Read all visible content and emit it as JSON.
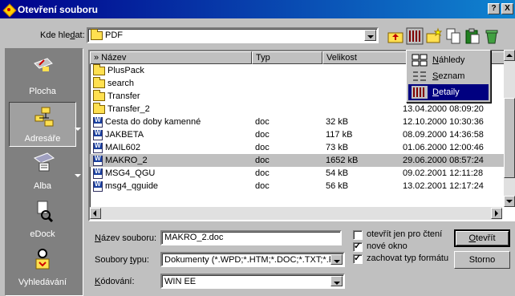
{
  "window": {
    "title": "Otevření souboru",
    "help_btn": "?",
    "close_btn": "X"
  },
  "lookin": {
    "label_pre": "Kde hle",
    "label_u": "d",
    "label_post": "at:",
    "value": "PDF"
  },
  "sidebar": [
    {
      "label": "Plocha"
    },
    {
      "label": "Adresáře"
    },
    {
      "label": "Alba"
    },
    {
      "label": "eDock"
    },
    {
      "label": "Vyhledávání"
    }
  ],
  "list": {
    "columns": [
      "» Název",
      "Typ",
      "Velikost",
      ""
    ],
    "rows": [
      {
        "name": "PlusPack",
        "type": "",
        "size": "",
        "date": "",
        "icon": "folder"
      },
      {
        "name": "search",
        "type": "",
        "size": "",
        "date": "",
        "icon": "folder"
      },
      {
        "name": "Transfer",
        "type": "",
        "size": "",
        "date": "",
        "icon": "folder"
      },
      {
        "name": "Transfer_2",
        "type": "",
        "size": "",
        "date": "13.04.2000 08:09:20",
        "icon": "folder"
      },
      {
        "name": "Cesta do doby kamenné",
        "type": "doc",
        "size": "32 kB",
        "date": "12.10.2000 10:30:36",
        "icon": "doc"
      },
      {
        "name": "JAKBETA",
        "type": "doc",
        "size": "117 kB",
        "date": "08.09.2000 14:36:58",
        "icon": "doc"
      },
      {
        "name": "MAIL602",
        "type": "doc",
        "size": "73 kB",
        "date": "01.06.2000 12:00:46",
        "icon": "doc"
      },
      {
        "name": "MAKRO_2",
        "type": "doc",
        "size": "1652 kB",
        "date": "29.06.2000 08:57:24",
        "icon": "doc"
      },
      {
        "name": "MSG4_QGU",
        "type": "doc",
        "size": "54 kB",
        "date": "09.02.2001 12:11:28",
        "icon": "doc"
      },
      {
        "name": "msg4_qguide",
        "type": "doc",
        "size": "56 kB",
        "date": "13.02.2001 12:17:24",
        "icon": "doc"
      }
    ],
    "selected_index": 7
  },
  "view_menu": {
    "items": [
      {
        "pre": "",
        "u": "N",
        "post": "áhledy"
      },
      {
        "pre": "",
        "u": "S",
        "post": "eznam"
      },
      {
        "pre": "",
        "u": "D",
        "post": "etaily"
      }
    ],
    "highlighted_index": 2
  },
  "filename": {
    "label_u": "N",
    "label_post": "ázev souboru:",
    "value": "MAKRO_2.doc"
  },
  "filetype": {
    "label_pre": "Soubory ",
    "label_u": "t",
    "label_post": "ypu:",
    "value": "Dokumenty (*.WPD;*.HTM;*.DOC;*.TXT;*.F"
  },
  "encoding": {
    "label_u": "K",
    "label_post": "ódování:",
    "value": "WIN EE"
  },
  "options": [
    {
      "label": "otevřít jen pro čtení",
      "checked": false
    },
    {
      "label": "nové okno",
      "checked": true
    },
    {
      "label": "zachovat typ formátu",
      "checked": true
    }
  ],
  "buttons": {
    "open_u": "O",
    "open_post": "tevřít",
    "cancel": "Storno"
  }
}
